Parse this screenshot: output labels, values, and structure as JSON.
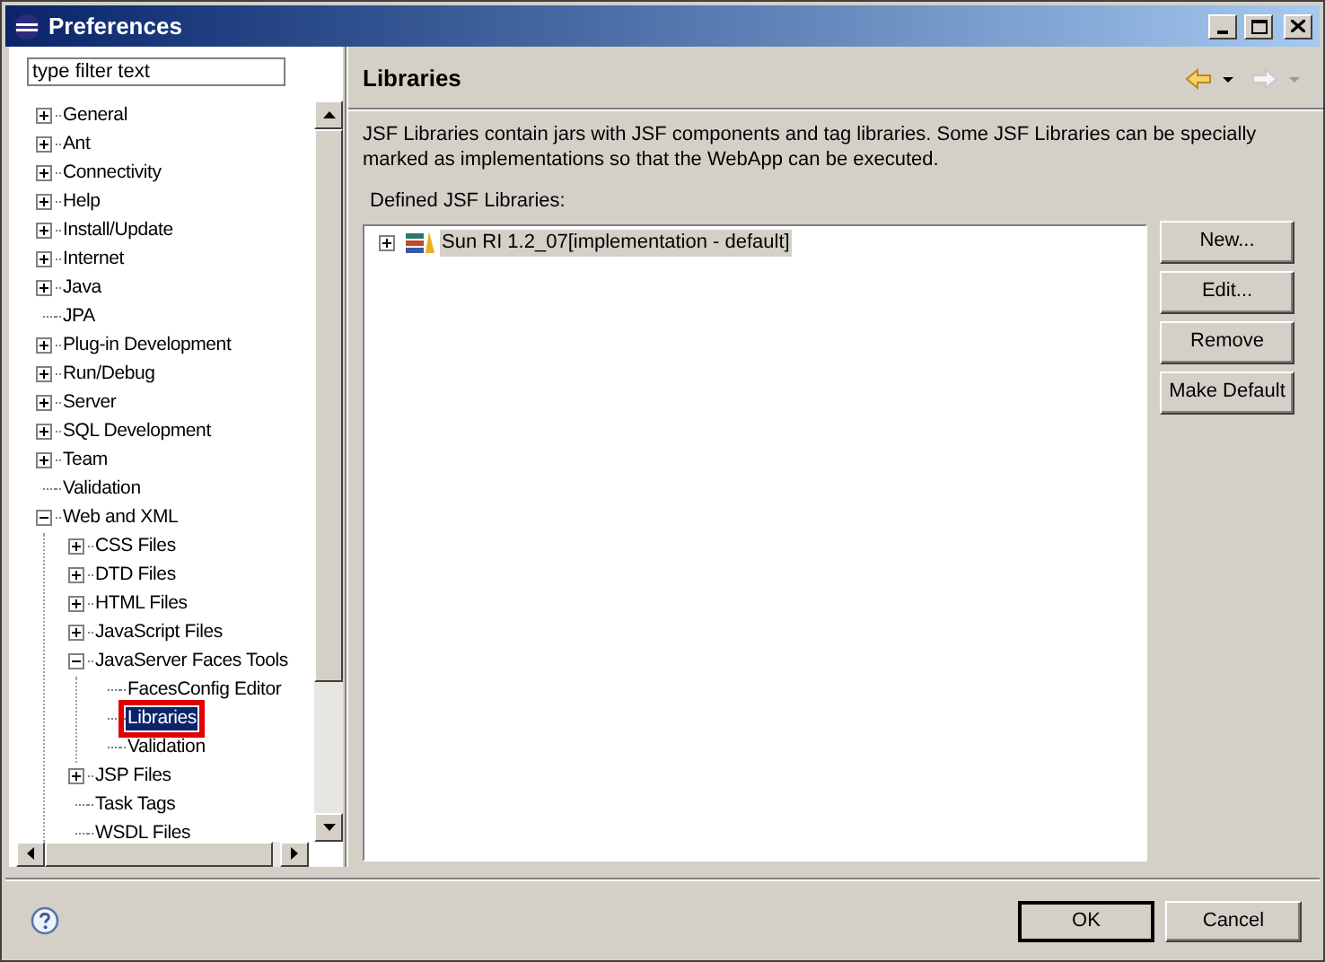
{
  "window": {
    "title": "Preferences"
  },
  "filter": {
    "placeholder": "type filter text"
  },
  "tree": [
    {
      "label": "General",
      "kind": "folder",
      "expanded": false,
      "selected": false,
      "annotated": false
    },
    {
      "label": "Ant",
      "kind": "folder",
      "expanded": false,
      "selected": false,
      "annotated": false
    },
    {
      "label": "Connectivity",
      "kind": "folder",
      "expanded": false,
      "selected": false,
      "annotated": false
    },
    {
      "label": "Help",
      "kind": "folder",
      "expanded": false,
      "selected": false,
      "annotated": false
    },
    {
      "label": "Install/Update",
      "kind": "folder",
      "expanded": false,
      "selected": false,
      "annotated": false
    },
    {
      "label": "Internet",
      "kind": "folder",
      "expanded": false,
      "selected": false,
      "annotated": false
    },
    {
      "label": "Java",
      "kind": "folder",
      "expanded": false,
      "selected": false,
      "annotated": false
    },
    {
      "label": "JPA",
      "kind": "leaf",
      "selected": false,
      "annotated": false
    },
    {
      "label": "Plug-in Development",
      "kind": "folder",
      "expanded": false,
      "selected": false,
      "annotated": false
    },
    {
      "label": "Run/Debug",
      "kind": "folder",
      "expanded": false,
      "selected": false,
      "annotated": false
    },
    {
      "label": "Server",
      "kind": "folder",
      "expanded": false,
      "selected": false,
      "annotated": false
    },
    {
      "label": "SQL Development",
      "kind": "folder",
      "expanded": false,
      "selected": false,
      "annotated": false
    },
    {
      "label": "Team",
      "kind": "folder",
      "expanded": false,
      "selected": false,
      "annotated": false
    },
    {
      "label": "Validation",
      "kind": "leaf",
      "selected": false,
      "annotated": false
    },
    {
      "label": "Web and XML",
      "kind": "folder",
      "expanded": true,
      "selected": false,
      "annotated": false,
      "children": [
        {
          "label": "CSS Files",
          "kind": "folder",
          "expanded": false,
          "selected": false,
          "annotated": false
        },
        {
          "label": "DTD Files",
          "kind": "folder",
          "expanded": false,
          "selected": false,
          "annotated": false
        },
        {
          "label": "HTML Files",
          "kind": "folder",
          "expanded": false,
          "selected": false,
          "annotated": false
        },
        {
          "label": "JavaScript Files",
          "kind": "folder",
          "expanded": false,
          "selected": false,
          "annotated": false
        },
        {
          "label": "JavaServer Faces Tools",
          "kind": "folder",
          "expanded": true,
          "selected": false,
          "annotated": false,
          "children": [
            {
              "label": "FacesConfig Editor",
              "kind": "leaf",
              "selected": false,
              "annotated": false
            },
            {
              "label": "Libraries",
              "kind": "leaf",
              "selected": true,
              "annotated": true
            },
            {
              "label": "Validation",
              "kind": "leaf",
              "selected": false,
              "annotated": false
            }
          ]
        },
        {
          "label": "JSP Files",
          "kind": "folder",
          "expanded": false,
          "selected": false,
          "annotated": false
        },
        {
          "label": "Task Tags",
          "kind": "leaf",
          "selected": false,
          "annotated": false
        },
        {
          "label": "WSDL Files",
          "kind": "leaf",
          "selected": false,
          "annotated": false
        }
      ]
    }
  ],
  "page": {
    "title": "Libraries",
    "description": "JSF Libraries contain jars with JSF components and tag libraries.   Some JSF Libraries can be specially marked as implementations so that the WebApp can be executed.",
    "list_label": "Defined JSF Libraries:",
    "libraries": [
      {
        "label": "Sun RI 1.2_07[implementation - default]",
        "expanded": false,
        "selected": true
      }
    ],
    "buttons": [
      "New...",
      "Edit...",
      "Remove",
      "Make Default"
    ]
  },
  "footer_buttons": [
    {
      "label": "OK",
      "default": true
    },
    {
      "label": "Cancel",
      "default": false
    }
  ]
}
